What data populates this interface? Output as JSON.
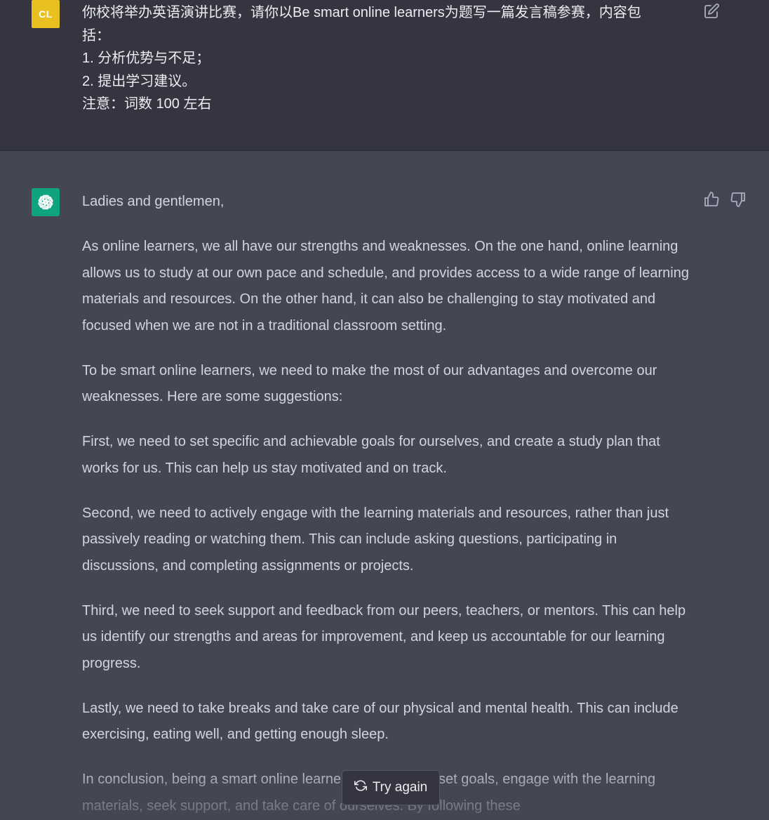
{
  "user": {
    "avatar_initials": "CL",
    "avatar_color": "#e8c01f",
    "lines": [
      "你校将举办英语演讲比赛，请你以Be smart online learners为题写一篇发言稿参赛，内容包",
      "括：",
      "1. 分析优势与不足；",
      "2. 提出学习建议。",
      "注意：词数 100 左右"
    ],
    "edit_icon": "edit-icon"
  },
  "assistant": {
    "avatar_icon": "openai-logo-icon",
    "avatar_color": "#10a37f",
    "paragraphs": [
      "Ladies and gentlemen,",
      "As online learners, we all have our strengths and weaknesses. On the one hand, online learning allows us to study at our own pace and schedule, and provides access to a wide range of learning materials and resources. On the other hand, it can also be challenging to stay motivated and focused when we are not in a traditional classroom setting.",
      "To be smart online learners, we need to make the most of our advantages and overcome our weaknesses. Here are some suggestions:",
      "First, we need to set specific and achievable goals for ourselves, and create a study plan that works for us. This can help us stay motivated and on track.",
      "Second, we need to actively engage with the learning materials and resources, rather than just passively reading or watching them. This can include asking questions, participating in discussions, and completing assignments or projects.",
      "Third, we need to seek support and feedback from our peers, teachers, or mentors. This can help us identify our strengths and areas for improvement, and keep us accountable for our learning progress.",
      "Lastly, we need to take breaks and take care of our physical and mental health. This can include exercising, eating well, and getting enough sleep.",
      "In conclusion, being a smart online learner requires us to set goals, engage with the learning materials, seek support, and take care of ourselves. By following these"
    ],
    "feedback_icons": [
      "thumbs-up-icon",
      "thumbs-down-icon"
    ]
  },
  "try_again": {
    "label": "Try again",
    "icon": "refresh-icon"
  },
  "colors": {
    "user_bg": "#343541",
    "assistant_bg": "#444654",
    "text": "#d1d5db"
  }
}
